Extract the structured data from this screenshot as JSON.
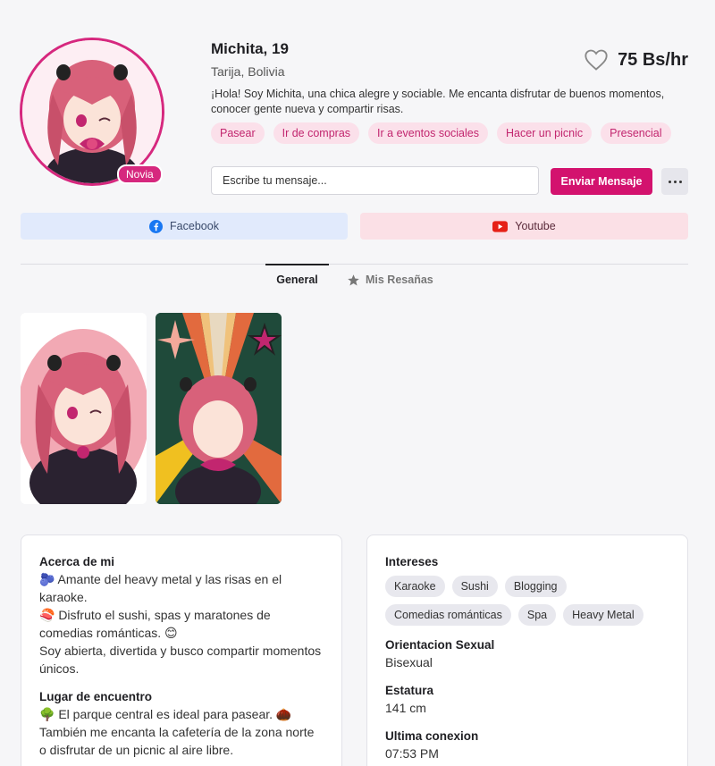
{
  "profile": {
    "name": "Michita, 19",
    "location": "Tarija, Bolivia",
    "bio": "¡Hola! Soy Michita, una chica alegre y sociable. Me encanta disfrutar de buenos momentos, conocer gente nueva y compartir risas.",
    "price": "75 Bs/hr",
    "badge": "Novia",
    "tags": [
      "Pasear",
      "Ir de compras",
      "Ir a eventos sociales",
      "Hacer un picnic",
      "Presencial"
    ]
  },
  "message": {
    "placeholder": "Escribe tu mensaje...",
    "send_label": "Enviar Mensaje"
  },
  "social": {
    "facebook": "Facebook",
    "youtube": "Youtube"
  },
  "tabs": {
    "general": "General",
    "reviews": "Mis Resañas"
  },
  "about": {
    "title": "Acerca de mi",
    "line1": "🫐 Amante del heavy metal y las risas en el karaoke.",
    "line2": "🍣 Disfruto el sushi, spas y maratones de comedias románticas. 😊",
    "line3": "Soy abierta, divertida y busco compartir momentos únicos."
  },
  "meeting": {
    "title": "Lugar de encuentro",
    "text": "🌳 El parque central es ideal para pasear. 🌰 También me encanta la cafetería de la zona norte o disfrutar de un picnic al aire libre."
  },
  "interests": {
    "title": "Intereses",
    "items": [
      "Karaoke",
      "Sushi",
      "Blogging",
      "Comedias románticas",
      "Spa",
      "Heavy Metal"
    ]
  },
  "orientation": {
    "title": "Orientacion Sexual",
    "value": "Bisexual"
  },
  "height": {
    "title": "Estatura",
    "value": "141 cm"
  },
  "last_seen": {
    "title": "Ultima conexion",
    "value": "07:53 PM"
  },
  "colors": {
    "accent": "#d3126e",
    "tag_bg": "#fbe0ea",
    "facebook_bg": "#e1eafc",
    "youtube_bg": "#fbe0e6"
  }
}
